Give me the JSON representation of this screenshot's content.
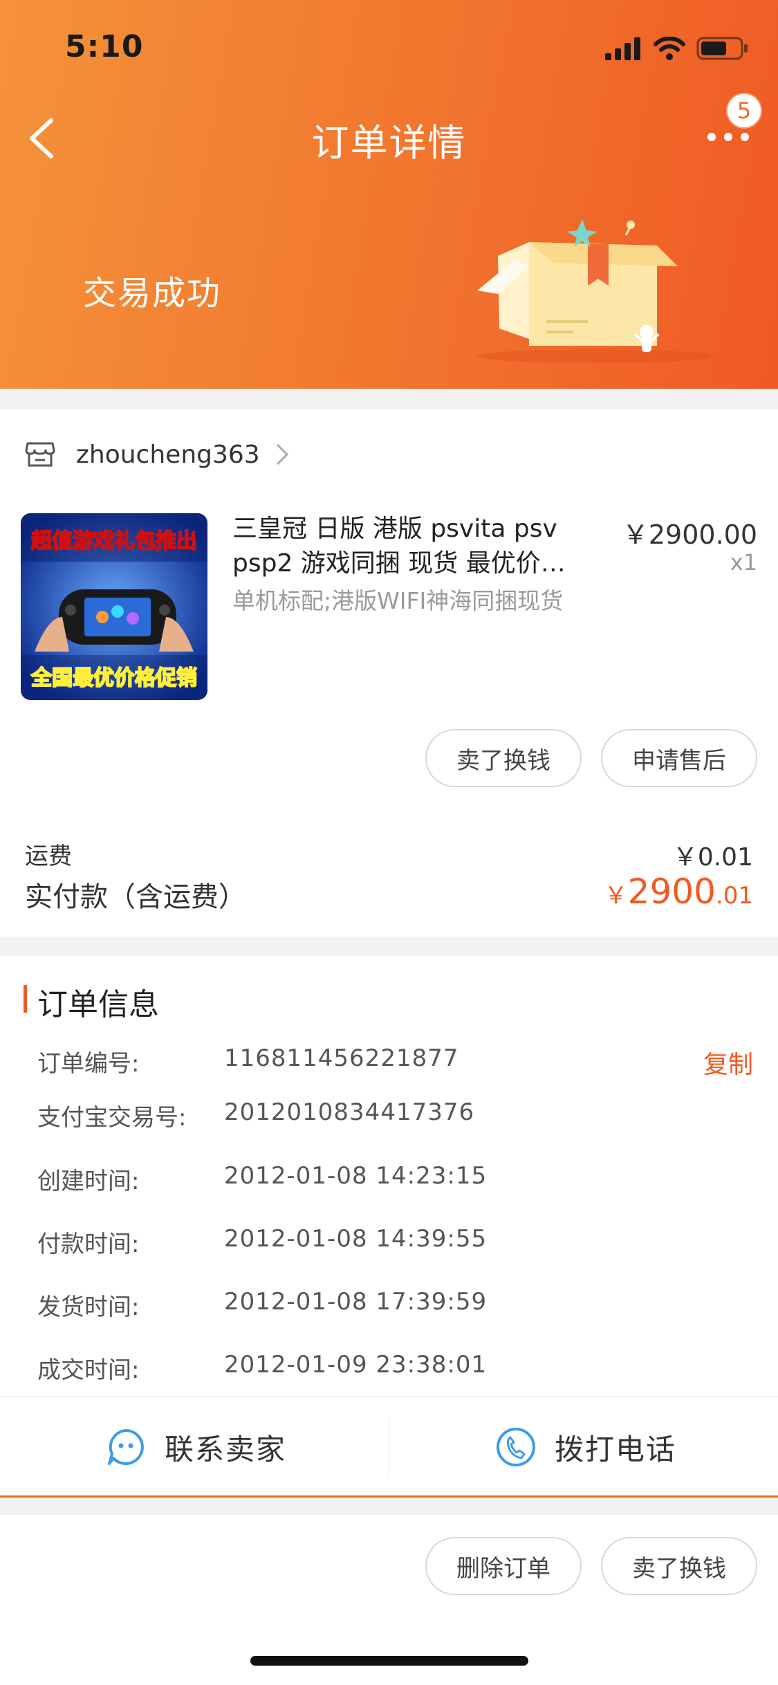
{
  "status_bar": {
    "time": "5:10"
  },
  "nav": {
    "title": "订单详情",
    "badge_count": "5"
  },
  "order_status": {
    "label": "交易成功"
  },
  "shop": {
    "name": "zhoucheng363"
  },
  "product": {
    "title": "三皇冠 日版 港版 psvita psv psp2 游戏同捆 现货 最优价…",
    "spec": "单机标配;港版WIFI神海同捆现货",
    "price": "￥2900.00",
    "qty": "x1",
    "thumb_top_text": "超值游戏礼包推出",
    "thumb_bottom_text": "全国最优价格促销"
  },
  "actions": {
    "sell_label": "卖了换钱",
    "after_sale_label": "申请售后"
  },
  "totals": {
    "shipping_label": "运费",
    "shipping_value": "￥0.01",
    "paid_label": "实付款（含运费）",
    "paid_currency": "￥",
    "paid_integer": "2900",
    "paid_decimal": ".01"
  },
  "order_info": {
    "title": "订单信息",
    "copy_label": "复制",
    "rows": [
      {
        "label": "订单编号:",
        "value": "116811456221877"
      },
      {
        "label": "支付宝交易号:",
        "value": "2012010834417376"
      },
      {
        "label": "创建时间:",
        "value": "2012-01-08 14:23:15"
      },
      {
        "label": "付款时间:",
        "value": "2012-01-08 14:39:55"
      },
      {
        "label": "发货时间:",
        "value": "2012-01-08 17:39:59"
      },
      {
        "label": "成交时间:",
        "value": "2012-01-09 23:38:01"
      }
    ]
  },
  "contact": {
    "seller_label": "联系卖家",
    "phone_label": "拨打电话"
  },
  "bottom": {
    "delete_label": "删除订单",
    "sell_label": "卖了换钱"
  },
  "colors": {
    "accent": "#f05a22",
    "header_start": "#f4923a",
    "header_end": "#ef5a24",
    "icon_blue": "#3d9be9"
  }
}
